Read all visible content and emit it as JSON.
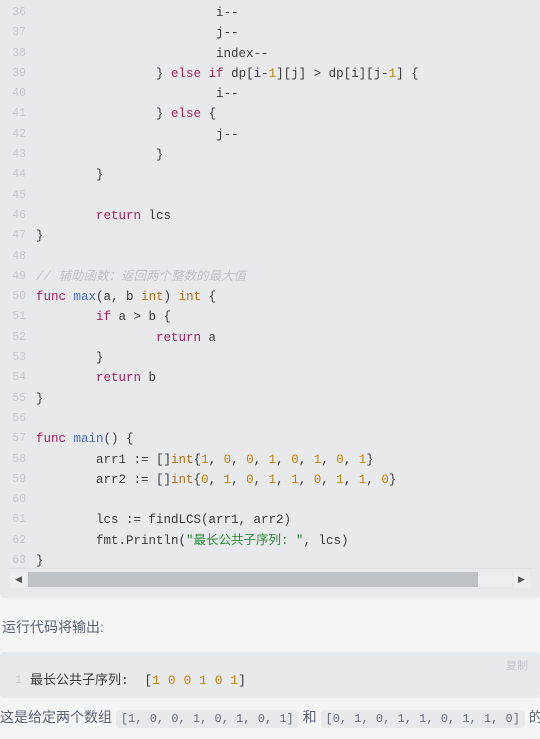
{
  "code_block": {
    "language": "go",
    "lines": [
      {
        "no": "36",
        "indent": 6,
        "tokens": [
          {
            "t": "i--",
            "c": "pl"
          }
        ]
      },
      {
        "no": "37",
        "indent": 6,
        "tokens": [
          {
            "t": "j--",
            "c": "pl"
          }
        ]
      },
      {
        "no": "38",
        "indent": 6,
        "tokens": [
          {
            "t": "index--",
            "c": "pl"
          }
        ]
      },
      {
        "no": "39",
        "indent": 4,
        "tokens": [
          {
            "t": "} ",
            "c": "pl"
          },
          {
            "t": "else",
            "c": "kw"
          },
          {
            "t": " ",
            "c": "pl"
          },
          {
            "t": "if",
            "c": "kw"
          },
          {
            "t": " dp[i-",
            "c": "pl"
          },
          {
            "t": "1",
            "c": "num"
          },
          {
            "t": "][j] > dp[i][j-",
            "c": "pl"
          },
          {
            "t": "1",
            "c": "num"
          },
          {
            "t": "] {",
            "c": "pl"
          }
        ]
      },
      {
        "no": "40",
        "indent": 6,
        "tokens": [
          {
            "t": "i--",
            "c": "pl"
          }
        ]
      },
      {
        "no": "41",
        "indent": 4,
        "tokens": [
          {
            "t": "} ",
            "c": "pl"
          },
          {
            "t": "else",
            "c": "kw"
          },
          {
            "t": " {",
            "c": "pl"
          }
        ]
      },
      {
        "no": "42",
        "indent": 6,
        "tokens": [
          {
            "t": "j--",
            "c": "pl"
          }
        ]
      },
      {
        "no": "43",
        "indent": 4,
        "tokens": [
          {
            "t": "}",
            "c": "pl"
          }
        ]
      },
      {
        "no": "44",
        "indent": 2,
        "tokens": [
          {
            "t": "}",
            "c": "pl"
          }
        ]
      },
      {
        "no": "45",
        "indent": 0,
        "tokens": []
      },
      {
        "no": "46",
        "indent": 2,
        "tokens": [
          {
            "t": "return",
            "c": "kw"
          },
          {
            "t": " lcs",
            "c": "pl"
          }
        ]
      },
      {
        "no": "47",
        "indent": 0,
        "tokens": [
          {
            "t": "}",
            "c": "pl"
          }
        ]
      },
      {
        "no": "48",
        "indent": 0,
        "tokens": []
      },
      {
        "no": "49",
        "indent": 0,
        "tokens": [
          {
            "t": "// 辅助函数：返回两个整数的最大值",
            "c": "cmt"
          }
        ]
      },
      {
        "no": "50",
        "indent": 0,
        "tokens": [
          {
            "t": "func",
            "c": "kw"
          },
          {
            "t": " ",
            "c": "pl"
          },
          {
            "t": "max",
            "c": "fn"
          },
          {
            "t": "(a, b ",
            "c": "pl"
          },
          {
            "t": "int",
            "c": "typ"
          },
          {
            "t": ") ",
            "c": "pl"
          },
          {
            "t": "int",
            "c": "typ"
          },
          {
            "t": " {",
            "c": "pl"
          }
        ]
      },
      {
        "no": "51",
        "indent": 2,
        "tokens": [
          {
            "t": "if",
            "c": "kw"
          },
          {
            "t": " a > b {",
            "c": "pl"
          }
        ]
      },
      {
        "no": "52",
        "indent": 4,
        "tokens": [
          {
            "t": "return",
            "c": "kw"
          },
          {
            "t": " a",
            "c": "pl"
          }
        ]
      },
      {
        "no": "53",
        "indent": 2,
        "tokens": [
          {
            "t": "}",
            "c": "pl"
          }
        ]
      },
      {
        "no": "54",
        "indent": 2,
        "tokens": [
          {
            "t": "return",
            "c": "kw"
          },
          {
            "t": " b",
            "c": "pl"
          }
        ]
      },
      {
        "no": "55",
        "indent": 0,
        "tokens": [
          {
            "t": "}",
            "c": "pl"
          }
        ]
      },
      {
        "no": "56",
        "indent": 0,
        "tokens": []
      },
      {
        "no": "57",
        "indent": 0,
        "tokens": [
          {
            "t": "func",
            "c": "kw"
          },
          {
            "t": " ",
            "c": "pl"
          },
          {
            "t": "main",
            "c": "fn"
          },
          {
            "t": "() {",
            "c": "pl"
          }
        ]
      },
      {
        "no": "58",
        "indent": 2,
        "tokens": [
          {
            "t": "arr1 := []",
            "c": "pl"
          },
          {
            "t": "int",
            "c": "typ"
          },
          {
            "t": "{",
            "c": "pl"
          },
          {
            "t": "1",
            "c": "num"
          },
          {
            "t": ", ",
            "c": "pl"
          },
          {
            "t": "0",
            "c": "num"
          },
          {
            "t": ", ",
            "c": "pl"
          },
          {
            "t": "0",
            "c": "num"
          },
          {
            "t": ", ",
            "c": "pl"
          },
          {
            "t": "1",
            "c": "num"
          },
          {
            "t": ", ",
            "c": "pl"
          },
          {
            "t": "0",
            "c": "num"
          },
          {
            "t": ", ",
            "c": "pl"
          },
          {
            "t": "1",
            "c": "num"
          },
          {
            "t": ", ",
            "c": "pl"
          },
          {
            "t": "0",
            "c": "num"
          },
          {
            "t": ", ",
            "c": "pl"
          },
          {
            "t": "1",
            "c": "num"
          },
          {
            "t": "}",
            "c": "pl"
          }
        ]
      },
      {
        "no": "59",
        "indent": 2,
        "tokens": [
          {
            "t": "arr2 := []",
            "c": "pl"
          },
          {
            "t": "int",
            "c": "typ"
          },
          {
            "t": "{",
            "c": "pl"
          },
          {
            "t": "0",
            "c": "num"
          },
          {
            "t": ", ",
            "c": "pl"
          },
          {
            "t": "1",
            "c": "num"
          },
          {
            "t": ", ",
            "c": "pl"
          },
          {
            "t": "0",
            "c": "num"
          },
          {
            "t": ", ",
            "c": "pl"
          },
          {
            "t": "1",
            "c": "num"
          },
          {
            "t": ", ",
            "c": "pl"
          },
          {
            "t": "1",
            "c": "num"
          },
          {
            "t": ", ",
            "c": "pl"
          },
          {
            "t": "0",
            "c": "num"
          },
          {
            "t": ", ",
            "c": "pl"
          },
          {
            "t": "1",
            "c": "num"
          },
          {
            "t": ", ",
            "c": "pl"
          },
          {
            "t": "1",
            "c": "num"
          },
          {
            "t": ", ",
            "c": "pl"
          },
          {
            "t": "0",
            "c": "num"
          },
          {
            "t": "}",
            "c": "pl"
          }
        ]
      },
      {
        "no": "60",
        "indent": 0,
        "tokens": []
      },
      {
        "no": "61",
        "indent": 2,
        "tokens": [
          {
            "t": "lcs := ",
            "c": "pl"
          },
          {
            "t": "findLCS",
            "c": "pl"
          },
          {
            "t": "(arr1, arr2)",
            "c": "pl"
          }
        ]
      },
      {
        "no": "62",
        "indent": 2,
        "tokens": [
          {
            "t": "fmt.Println(",
            "c": "pl"
          },
          {
            "t": "\"最长公共子序列: \"",
            "c": "str"
          },
          {
            "t": ", lcs)",
            "c": "pl"
          }
        ]
      },
      {
        "no": "63",
        "indent": 0,
        "tokens": [
          {
            "t": "}",
            "c": "pl"
          }
        ]
      }
    ]
  },
  "scrollbar": {
    "left_arrow": "◀",
    "right_arrow": "▶",
    "thumb_percent": 93
  },
  "paragraphs": {
    "run_output_label": "运行代码将输出:",
    "explanation_prefix": "这是给定两个数组 ",
    "explanation_array1": "[1, 0, 0, 1, 0, 1, 0, 1]",
    "explanation_middle": " 和 ",
    "explanation_array2": "[0, 1, 0, 1, 1, 0, 1, 1, 0]",
    "explanation_suffix": " 的最长公共子"
  },
  "output_block": {
    "copy_label": "复制",
    "line_no": "1",
    "text_prefix": "最长公共子序列:  [",
    "values": [
      "1",
      "0",
      "0",
      "1",
      "0",
      "1"
    ],
    "text_suffix": "]"
  }
}
